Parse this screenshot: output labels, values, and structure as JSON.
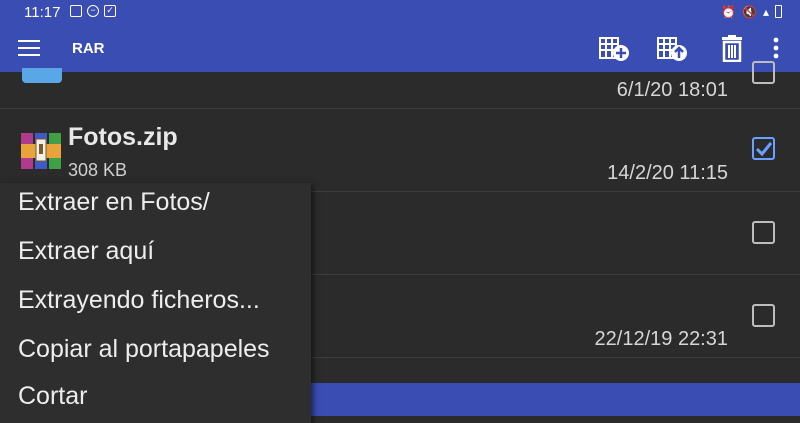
{
  "status_bar": {
    "time": "11:17",
    "icons": [
      "image-icon",
      "dnd-icon",
      "check-icon",
      "alarm-icon",
      "mute-icon",
      "signal-icon",
      "battery-icon"
    ]
  },
  "app_bar": {
    "title": "RAR",
    "actions": [
      "add-to-archive-icon",
      "extract-icon",
      "delete-icon",
      "more-icon"
    ]
  },
  "files": [
    {
      "name": "",
      "size": "",
      "date": "6/1/20 18:01",
      "checked": false
    },
    {
      "name": "Fotos.zip",
      "size": "308 KB",
      "date": "14/2/20 11:15",
      "checked": true
    },
    {
      "name": "",
      "size": "",
      "date": "",
      "checked": false
    },
    {
      "name": "",
      "size": "",
      "date": "22/12/19 22:31",
      "checked": false
    }
  ],
  "context_menu": {
    "items": [
      "Extraer en Fotos/",
      "Extraer aquí",
      "Extrayendo ficheros...",
      "Copiar al portapapeles",
      "Cortar"
    ]
  },
  "colors": {
    "primary": "#3a4db2",
    "background": "#2b2b2b",
    "accent": "#6aa0ff"
  }
}
